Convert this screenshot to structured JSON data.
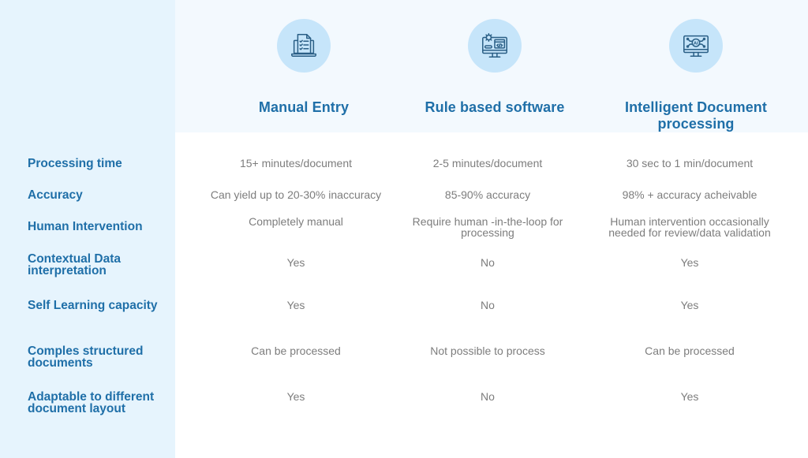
{
  "columns": [
    {
      "title": "Manual Entry",
      "icon": "laptop-document-checklist-icon"
    },
    {
      "title": "Rule based software",
      "icon": "monitor-gear-code-icon"
    },
    {
      "title": "Intelligent Document processing",
      "icon": "monitor-ai-circuit-icon"
    }
  ],
  "rows": [
    {
      "label": "Processing time",
      "values": [
        "15+ minutes/document",
        "2-5 minutes/document",
        "30 sec to 1 min/document"
      ]
    },
    {
      "label": "Accuracy",
      "values": [
        "Can yield up to 20-30% inaccuracy",
        "85-90% accuracy",
        "98% + accuracy acheivable"
      ]
    },
    {
      "label": "Human Intervention",
      "values": [
        "Completely manual",
        "Require human -in-the-loop for processing",
        "Human intervention occasionally needed for review/data validation"
      ]
    },
    {
      "label": "Contextual Data interpretation",
      "values": [
        "Yes",
        "No",
        "Yes"
      ]
    },
    {
      "label": "Self Learning capacity",
      "values": [
        "Yes",
        "No",
        "Yes"
      ]
    },
    {
      "label": "Comples structured documents",
      "values": [
        "Can be processed",
        "Not possible to process",
        "Can be processed"
      ]
    },
    {
      "label": "Adaptable to different document layout",
      "values": [
        "Yes",
        "No",
        "Yes"
      ]
    }
  ],
  "colors": {
    "accent_text": "#1f6fa8",
    "cell_text": "#7d7d7d",
    "left_column_bg": "#e6f4fd",
    "header_band_bg": "#f3f9fe",
    "icon_circle_bg": "#c6e5fa"
  }
}
